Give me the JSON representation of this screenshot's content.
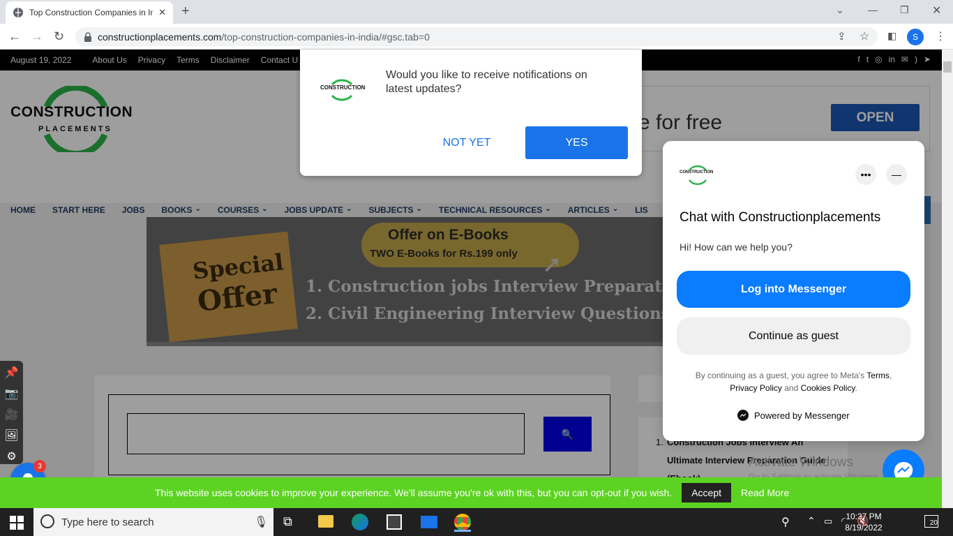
{
  "browser": {
    "tab_title": "Top Construction Companies in In",
    "new_tab": "+",
    "url_domain": "constructionplacements.com",
    "url_path": "/top-construction-companies-in-india/#gsc.tab=0",
    "profile_initial": "S"
  },
  "topbar": {
    "date": "August 19, 2022",
    "links": [
      "About Us",
      "Privacy",
      "Terms",
      "Disclaimer",
      "Contact U"
    ]
  },
  "header": {
    "logo_line1": "CONSTRUCTION",
    "logo_line2": "PLACEMENTS",
    "ad_text": "e for free",
    "open_button": "OPEN"
  },
  "menu": [
    "HOME",
    "START HERE",
    "JOBS",
    "BOOKS",
    "COURSES",
    "JOBS UPDATE",
    "SUBJECTS",
    "TECHNICAL RESOURCES",
    "ARTICLES",
    "LIS"
  ],
  "menu_dropdown": [
    false,
    false,
    false,
    true,
    true,
    true,
    true,
    true,
    true,
    false
  ],
  "banner": {
    "badge_line1": "Special",
    "badge_line2": "Offer",
    "pill_title": "Offer on E-Books",
    "pill_sub": "TWO E-Books for Rs.199 only",
    "item1": "1. Construction jobs Interview Preparation Guide",
    "item2": "2. Civil Engineering Interview Questions and An"
  },
  "search": {
    "button_icon": "search-icon"
  },
  "sidebar_post": {
    "number": "1.",
    "lines": [
      "Construction Jobs Interview An",
      "Ultimate Interview Preparation Guide",
      "(Ebook)"
    ]
  },
  "watermark": {
    "title": "Activate Windows",
    "sub": "Go to Settings to activate Windows."
  },
  "notification": {
    "logo_text": "CONSTRUCTION",
    "message": "Would you like to receive notifications on latest updates?",
    "not_yet": "NOT YET",
    "yes": "YES"
  },
  "messenger": {
    "logo_text": "CONSTRUCTION",
    "title": "Chat with Constructionplacements",
    "subtitle": "Hi! How can we help you?",
    "login": "Log into Messenger",
    "guest": "Continue as guest",
    "terms_prefix": "By continuing as a guest, you agree to Meta's",
    "terms_link": "Terms",
    "privacy_link": "Privacy Policy",
    "and": "and",
    "cookies_link": "Cookies Policy",
    "powered": "Powered by Messenger",
    "more": "•••"
  },
  "bell_badge": "3",
  "cookie": {
    "message": "This website uses cookies to improve your experience. We'll assume you're ok with this, but you can opt-out if you wish.",
    "accept": "Accept",
    "read_more": "Read More"
  },
  "taskbar": {
    "search_placeholder": "Type here to search",
    "time": "10:37 PM",
    "date": "8/19/2022",
    "notification_count": "20"
  },
  "colors": {
    "brand_green": "#2db34a",
    "cookie_green": "#5cd322",
    "messenger_blue": "#0a7cff",
    "notif_blue": "#1a73e8"
  }
}
